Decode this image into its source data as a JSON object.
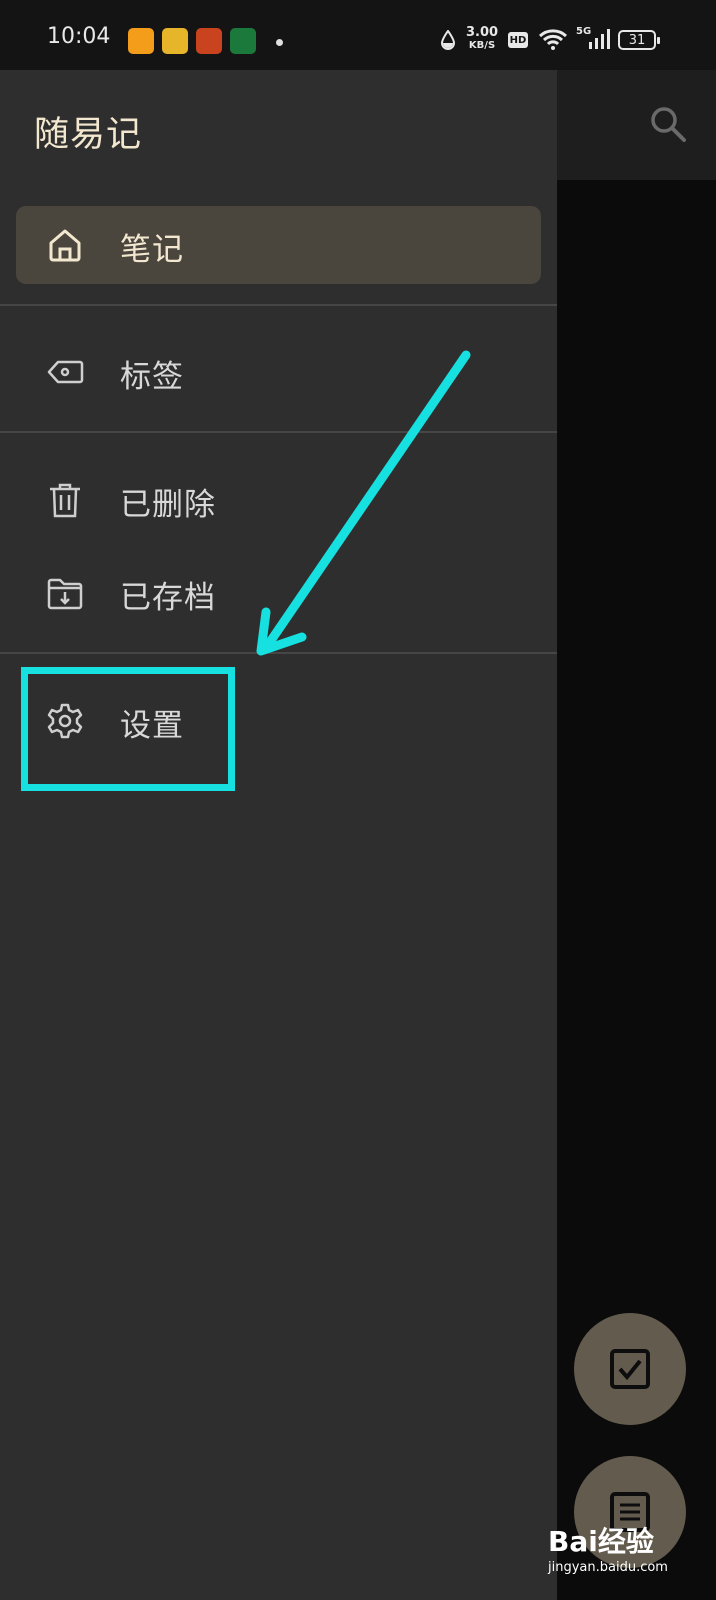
{
  "status_bar": {
    "time": "10:04",
    "net_speed": "3.00",
    "net_unit": "KB/S",
    "hd_badge": "HD",
    "network": "5G",
    "battery": "31"
  },
  "drawer": {
    "app_title": "随易记",
    "items": [
      {
        "label": "笔记",
        "icon": "home-icon",
        "active": true
      },
      {
        "label": "标签",
        "icon": "tag-icon"
      },
      {
        "label": "已删除",
        "icon": "trash-icon"
      },
      {
        "label": "已存档",
        "icon": "archive-icon"
      },
      {
        "label": "设置",
        "icon": "gear-icon"
      }
    ]
  },
  "background": {
    "search_icon": "search-icon",
    "fabs": [
      "checkbox-icon",
      "list-icon"
    ]
  },
  "watermark": {
    "brand": "Bai经验",
    "url": "jingyan.baidu.com"
  },
  "colors": {
    "annotation": "#16e0e0",
    "drawer_bg": "#2e2e2e",
    "active_bg": "#4a463e",
    "accent_text": "#f3e8cf"
  }
}
